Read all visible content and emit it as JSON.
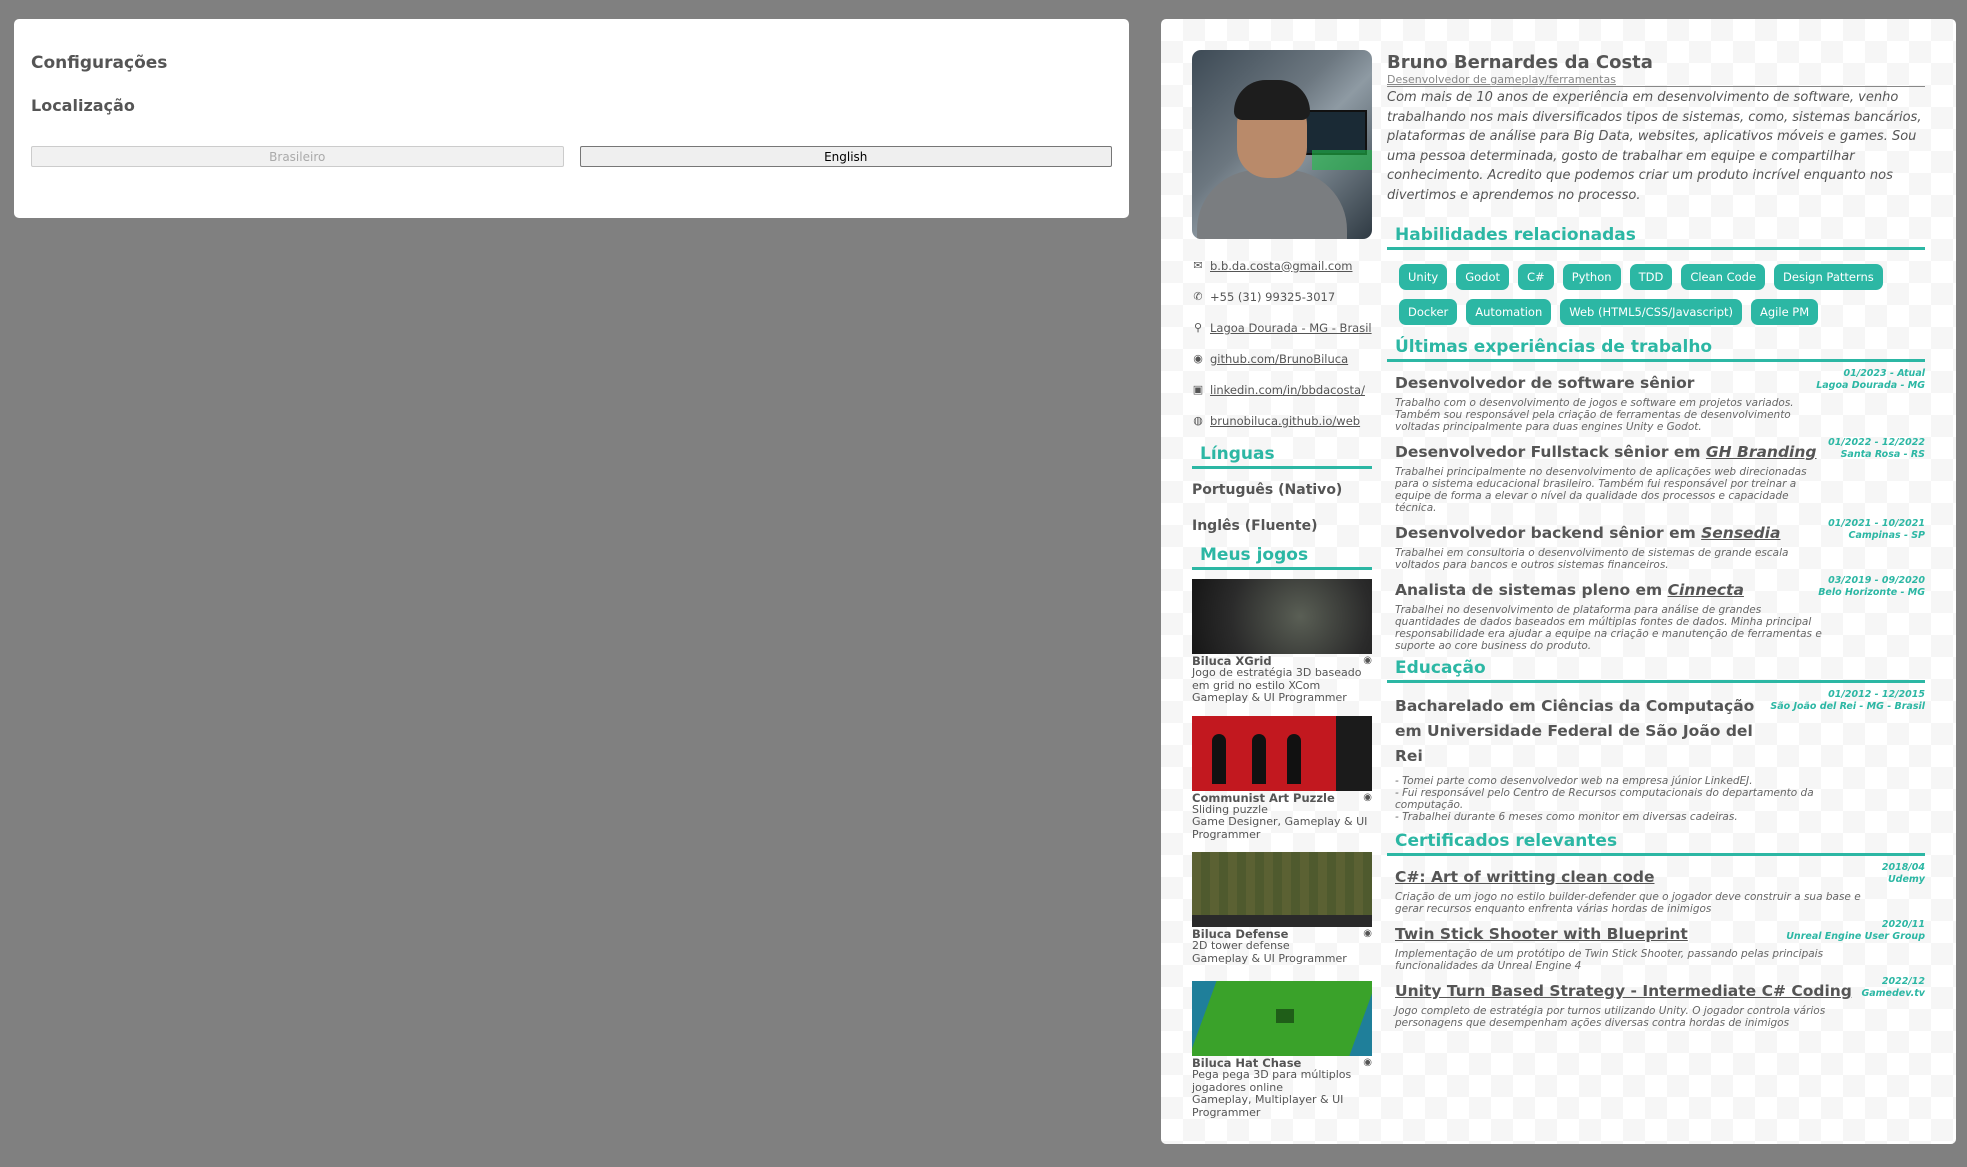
{
  "settings": {
    "title": "Configurações",
    "localization_label": "Localização",
    "lang_pt": "Brasileiro",
    "lang_en": "English"
  },
  "profile": {
    "name": "Bruno Bernardes da Costa",
    "role": "Desenvolvedor de gameplay/ferramentas",
    "about": "Com mais de 10 anos de experiência em desenvolvimento de software, venho trabalhando nos mais diversificados tipos de sistemas, como, sistemas bancários, plataformas de análise para Big Data, websites, aplicativos móveis e games. Sou uma pessoa determinada, gosto de trabalhar em equipe e compartilhar conhecimento. Acredito que podemos criar um produto incrível enquanto nos divertimos e aprendemos no processo."
  },
  "contacts": [
    {
      "icon": "mail-icon",
      "glyph": "✉",
      "text": "b.b.da.costa@gmail.com",
      "link": true
    },
    {
      "icon": "phone-icon",
      "glyph": "✆",
      "text": "+55 (31) 99325-3017",
      "link": false
    },
    {
      "icon": "location-icon",
      "glyph": "⚲",
      "text": "Lagoa Dourada - MG - Brasil",
      "link": true
    },
    {
      "icon": "github-icon",
      "glyph": "◉",
      "text": "github.com/BrunoBiluca",
      "link": true
    },
    {
      "icon": "linkedin-icon",
      "glyph": "▣",
      "text": "linkedin.com/in/bbdacosta/",
      "link": true
    },
    {
      "icon": "globe-icon",
      "glyph": "◍",
      "text": "brunobiluca.github.io/web",
      "link": true
    }
  ],
  "languages": {
    "title": "Línguas",
    "items": [
      "Português (Nativo)",
      "Inglês (Fluente)"
    ]
  },
  "games": {
    "title": "Meus jogos",
    "items": [
      {
        "title": "Biluca XGrid",
        "desc": "Jogo de estratégia 3D baseado em grid no estilo XCom",
        "role": "Gameplay & UI Programmer"
      },
      {
        "title": "Communist Art Puzzle",
        "desc": "Sliding puzzle",
        "role": "Game Designer, Gameplay & UI Programmer"
      },
      {
        "title": "Biluca Defense",
        "desc": "2D tower defense",
        "role": "Gameplay & UI Programmer"
      },
      {
        "title": "Biluca Hat Chase",
        "desc": "Pega pega 3D para múltiplos jogadores online",
        "role": "Gameplay, Multiplayer & UI Programmer"
      }
    ]
  },
  "skills": {
    "title": "Habilidades relacionadas",
    "items": [
      "Unity",
      "Godot",
      "C#",
      "Python",
      "TDD",
      "Clean Code",
      "Design Patterns",
      "Docker",
      "Automation",
      "Web (HTML5/CSS/Javascript)",
      "Agile PM"
    ]
  },
  "experience": {
    "title": "Últimas experiências de trabalho",
    "items": [
      {
        "title": "Desenvolvedor de software sênior",
        "company": "",
        "date": "01/2023 - Atual",
        "place": "Lagoa Dourada - MG",
        "desc": "Trabalho com o desenvolvimento de jogos e software em projetos variados. Também sou responsável pela criação de ferramentas de desenvolvimento voltadas principalmente para duas engines Unity e Godot."
      },
      {
        "title": "Desenvolvedor Fullstack sênior em ",
        "company": "GH Branding",
        "date": "01/2022 - 12/2022",
        "place": "Santa Rosa - RS",
        "desc": "Trabalhei principalmente no desenvolvimento de aplicações web direcionadas para o sistema educacional brasileiro. Também fui responsável por treinar a equipe de forma a elevar o nível da qualidade dos processos e capacidade técnica."
      },
      {
        "title": "Desenvolvedor backend sênior em ",
        "company": "Sensedia",
        "date": "01/2021 - 10/2021",
        "place": "Campinas - SP",
        "desc": "Trabalhei em consultoria o desenvolvimento de sistemas de grande escala voltados para bancos e outros sistemas financeiros."
      },
      {
        "title": "Analista de sistemas pleno em ",
        "company": "Cinnecta",
        "date": "03/2019 - 09/2020",
        "place": "Belo Horizonte - MG",
        "desc": "Trabalhei no desenvolvimento de plataforma para análise de grandes quantidades de dados baseados em múltiplas fontes de dados. Minha principal responsabilidade era ajudar a equipe na criação e manutenção de ferramentas e suporte ao core business do produto."
      }
    ]
  },
  "education": {
    "title": "Educação",
    "items": [
      {
        "title": "Bacharelado em Ciências da Computação em Universidade Federal de São João del Rei",
        "date": "01/2012 - 12/2015",
        "place": "São João del Rei - MG - Brasil",
        "desc": "- Tomei parte como desenvolvedor web na empresa júnior LinkedEJ.\n- Fui responsável pelo Centro de Recursos computacionais do departamento da computação.\n- Trabalhei durante 6 meses como monitor em diversas cadeiras."
      }
    ]
  },
  "certificates": {
    "title": "Certificados relevantes",
    "items": [
      {
        "title": "C#: Art of writting clean code",
        "date": "2018/04",
        "place": "Udemy",
        "desc": "Criação de um jogo no estilo builder-defender que o jogador deve construir a sua base e gerar recursos enquanto enfrenta várias hordas de inimigos"
      },
      {
        "title": "Twin Stick Shooter with Blueprint",
        "date": "2020/11",
        "place": "Unreal Engine User Group",
        "desc": "Implementação de um protótipo de Twin Stick Shooter, passando pelas principais funcionalidades da Unreal Engine 4"
      },
      {
        "title": "Unity Turn Based Strategy - Intermediate C# Coding",
        "date": "2022/12",
        "place": "Gamedev.tv",
        "desc": "Jogo completo de estratégia por turnos utilizando Unity. O jogador controla vários personagens que desempenham ações diversas contra hordas de inimigos"
      }
    ]
  }
}
